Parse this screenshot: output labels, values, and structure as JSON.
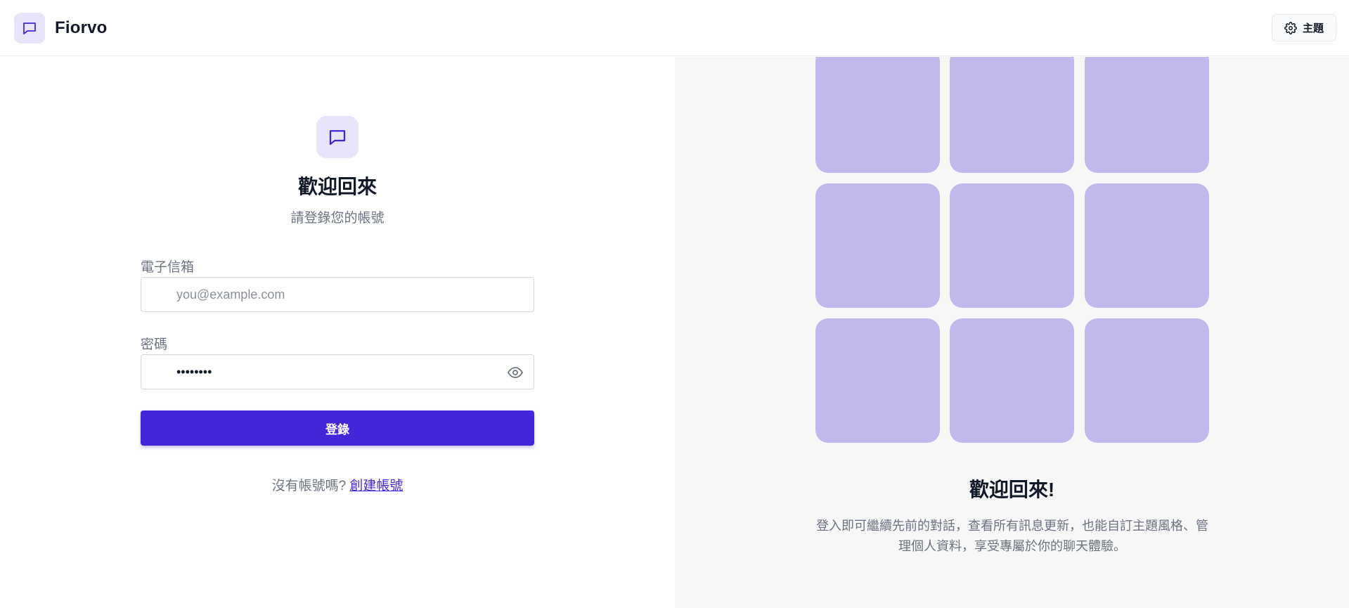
{
  "header": {
    "brand_name": "Fiorvo",
    "theme_label": "主題"
  },
  "login": {
    "title": "歡迎回來",
    "subtitle": "請登錄您的帳號",
    "email_label": "電子信箱",
    "email_placeholder": "you@example.com",
    "email_value": "",
    "password_label": "密碼",
    "password_value": "password",
    "submit_label": "登錄",
    "no_account_text": "沒有帳號嗎?",
    "create_account_link": "創建帳號"
  },
  "showcase": {
    "title": "歡迎回來!",
    "description": "登入即可繼續先前的對話，查看所有訊息更新，也能自訂主題風格、管理個人資料，享受專屬於你的聊天體驗。",
    "tile_color": "#c1b9ec"
  },
  "colors": {
    "accent": "#4326d8",
    "accent_light": "#e8e4fa",
    "panel_bg": "#f7f7f7"
  },
  "icons": {
    "brand_icon": "chat-bubble-icon",
    "theme_icon": "gear-icon",
    "password_toggle_icon": "eye-icon"
  }
}
